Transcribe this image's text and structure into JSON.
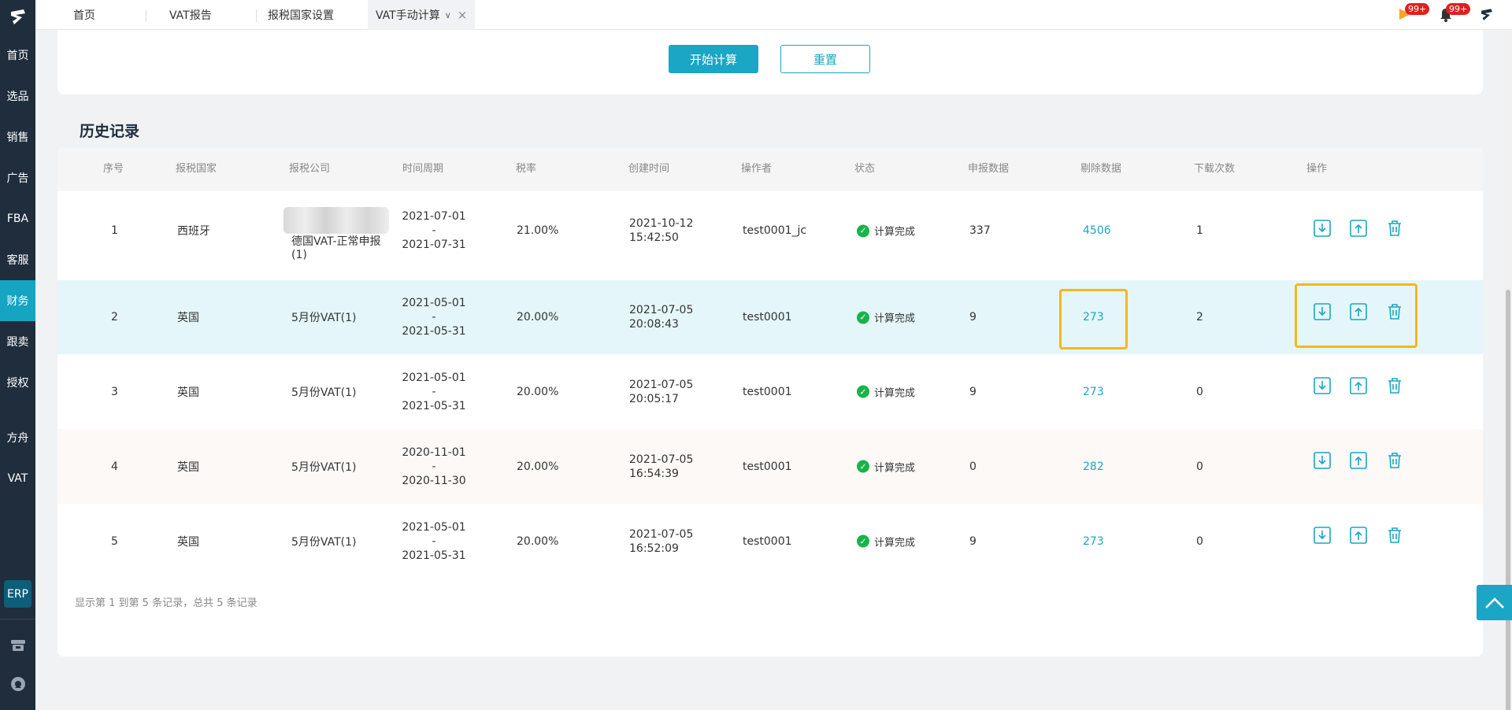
{
  "sidebar": {
    "items": [
      {
        "label": "首页"
      },
      {
        "label": "选品"
      },
      {
        "label": "销售"
      },
      {
        "label": "广告"
      },
      {
        "label": "FBA"
      },
      {
        "label": "客服"
      },
      {
        "label": "财务",
        "active": true
      },
      {
        "label": "跟卖"
      },
      {
        "label": "授权"
      },
      {
        "label": "方舟"
      },
      {
        "label": "VAT"
      }
    ],
    "erp_label": "ERP",
    "bg_color": "#1f2d3d",
    "active_color": "#15a4c2"
  },
  "topbar": {
    "tabs": [
      {
        "label": "首页"
      },
      {
        "label": "VAT报告"
      },
      {
        "label": "报税国家设置"
      },
      {
        "label": "VAT手动计算",
        "active": true
      }
    ],
    "notif_badge_1": "99+",
    "notif_badge_2": "99+"
  },
  "actions": {
    "start_label": "开始计算",
    "reset_label": "重置"
  },
  "history": {
    "title": "历史记录",
    "columns": [
      "序号",
      "报税国家",
      "报税公司",
      "时间周期",
      "税率",
      "创建时间",
      "操作者",
      "状态",
      "申报数据",
      "剔除数据",
      "下载次数",
      "操作"
    ],
    "rows": [
      {
        "index": "1",
        "country": "西班牙",
        "company": "德国VAT-正常申报(1)",
        "period_start": "2021-07-01",
        "period_sep": "-",
        "period_end": "2021-07-31",
        "rate": "21.00%",
        "created_date": "2021-10-12",
        "created_time": "15:42:50",
        "operator": "test0001_jc",
        "status": "计算完成",
        "declared": "337",
        "removed": "4506",
        "downloads": "1"
      },
      {
        "index": "2",
        "country": "英国",
        "company": "5月份VAT(1)",
        "period_start": "2021-05-01",
        "period_sep": "-",
        "period_end": "2021-05-31",
        "rate": "20.00%",
        "created_date": "2021-07-05",
        "created_time": "20:08:43",
        "operator": "test0001",
        "status": "计算完成",
        "declared": "9",
        "removed": "273",
        "downloads": "2"
      },
      {
        "index": "3",
        "country": "英国",
        "company": "5月份VAT(1)",
        "period_start": "2021-05-01",
        "period_sep": "-",
        "period_end": "2021-05-31",
        "rate": "20.00%",
        "created_date": "2021-07-05",
        "created_time": "20:05:17",
        "operator": "test0001",
        "status": "计算完成",
        "declared": "9",
        "removed": "273",
        "downloads": "0"
      },
      {
        "index": "4",
        "country": "英国",
        "company": "5月份VAT(1)",
        "period_start": "2020-11-01",
        "period_sep": "-",
        "period_end": "2020-11-30",
        "rate": "20.00%",
        "created_date": "2021-07-05",
        "created_time": "16:54:39",
        "operator": "test0001",
        "status": "计算完成",
        "declared": "0",
        "removed": "282",
        "downloads": "0"
      },
      {
        "index": "5",
        "country": "英国",
        "company": "5月份VAT(1)",
        "period_start": "2021-05-01",
        "period_sep": "-",
        "period_end": "2021-05-31",
        "rate": "20.00%",
        "created_date": "2021-07-05",
        "created_time": "16:52:09",
        "operator": "test0001",
        "status": "计算完成",
        "declared": "9",
        "removed": "273",
        "downloads": "0"
      }
    ],
    "footer": "显示第 1 到第 5 条记录，总共 5 条记录"
  },
  "colors": {
    "accent": "#1aa6c4",
    "highlight_row": "#e4f6f9",
    "annotation": "#f6b71b",
    "success": "#19b34a"
  }
}
